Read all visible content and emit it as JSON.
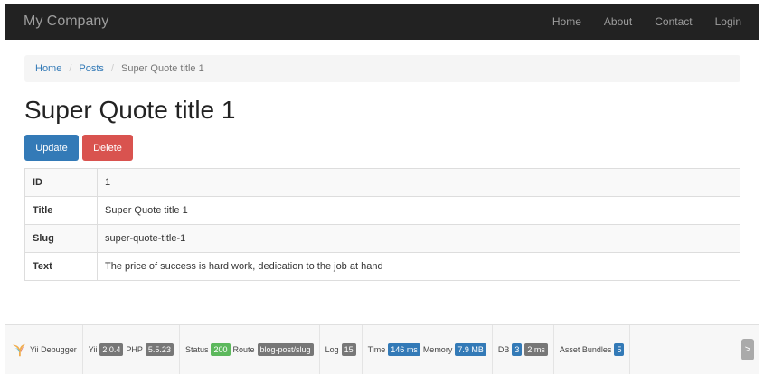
{
  "navbar": {
    "brand": "My Company",
    "items": [
      {
        "label": "Home"
      },
      {
        "label": "About"
      },
      {
        "label": "Contact"
      },
      {
        "label": "Login"
      }
    ]
  },
  "breadcrumb": {
    "items": [
      "Home",
      "Posts"
    ],
    "active": "Super Quote title 1"
  },
  "page": {
    "title": "Super Quote title 1"
  },
  "actions": {
    "update_label": "Update",
    "delete_label": "Delete"
  },
  "detail": {
    "rows": [
      {
        "label": "ID",
        "value": "1"
      },
      {
        "label": "Title",
        "value": "Super Quote title 1"
      },
      {
        "label": "Slug",
        "value": "super-quote-title-1"
      },
      {
        "label": "Text",
        "value": "The price of success is hard work, dedication to the job at hand"
      }
    ]
  },
  "debugbar": {
    "name": "Yii Debugger",
    "yii_label": "Yii",
    "yii_version": "2.0.4",
    "php_label": "PHP",
    "php_version": "5.5.23",
    "status_label": "Status",
    "status_value": "200",
    "route_label": "Route",
    "route_value": "blog-post/slug",
    "log_label": "Log",
    "log_value": "15",
    "time_label": "Time",
    "time_value": "146 ms",
    "memory_label": "Memory",
    "memory_value": "7.9 MB",
    "db_label": "DB",
    "db_queries": "3",
    "db_time": "2 ms",
    "asset_label": "Asset Bundles",
    "asset_value": "5",
    "toggle_glyph": ">"
  }
}
